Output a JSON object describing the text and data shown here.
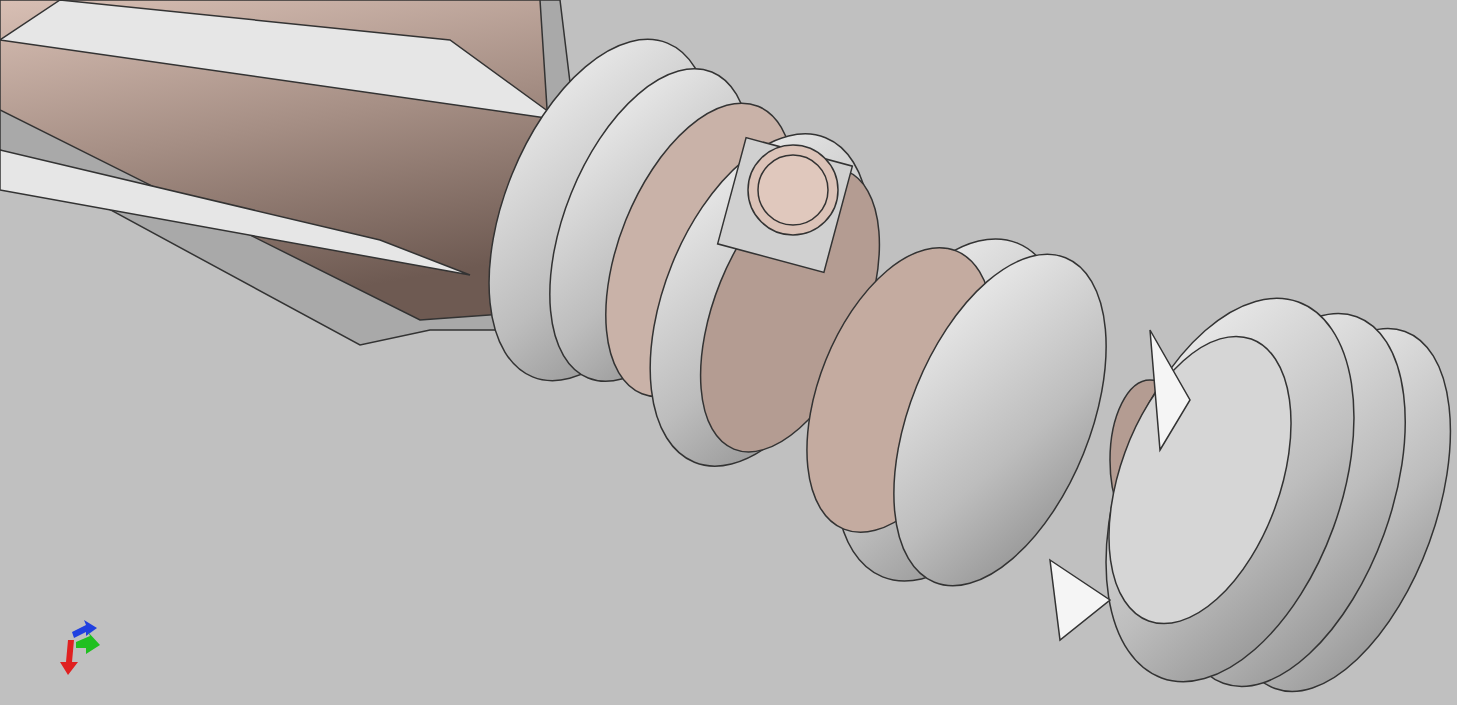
{
  "viewport": {
    "show_axis_triad": true
  }
}
